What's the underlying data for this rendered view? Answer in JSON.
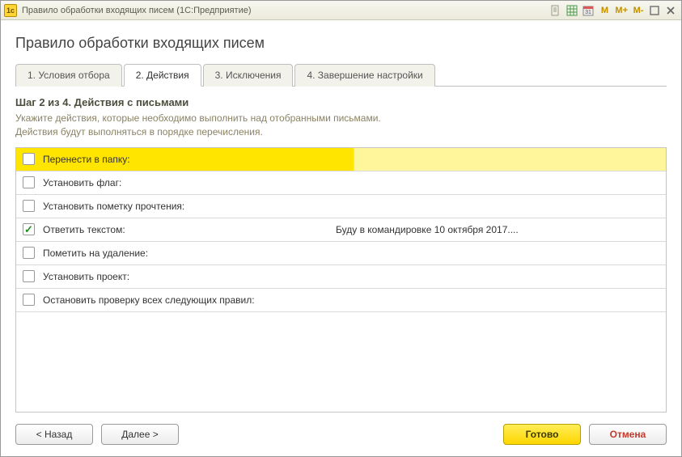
{
  "window": {
    "title": "Правило обработки входящих писем  (1С:Предприятие)"
  },
  "page": {
    "title": "Правило обработки входящих писем"
  },
  "tabs": [
    {
      "label": "1. Условия отбора"
    },
    {
      "label": "2. Действия"
    },
    {
      "label": "3. Исключения"
    },
    {
      "label": "4. Завершение настройки"
    }
  ],
  "step": {
    "title": "Шаг 2 из 4. Действия с письмами",
    "hint1": "Укажите действия, которые необходимо выполнить над отобранными письмами.",
    "hint2": "Действия будут выполняться в порядке перечисления."
  },
  "actions": [
    {
      "checked": false,
      "selected": true,
      "label": "Перенести в папку:",
      "value": ""
    },
    {
      "checked": false,
      "selected": false,
      "label": "Установить флаг:",
      "value": ""
    },
    {
      "checked": false,
      "selected": false,
      "label": "Установить пометку прочтения:",
      "value": ""
    },
    {
      "checked": true,
      "selected": false,
      "label": "Ответить текстом:",
      "value": "Буду в командировке 10 октября 2017...."
    },
    {
      "checked": false,
      "selected": false,
      "label": "Пометить на удаление:",
      "value": ""
    },
    {
      "checked": false,
      "selected": false,
      "label": "Установить проект:",
      "value": ""
    },
    {
      "checked": false,
      "selected": false,
      "label": "Остановить проверку всех следующих правил:",
      "value": ""
    }
  ],
  "buttons": {
    "back": "< Назад",
    "next": "Далее >",
    "finish": "Готово",
    "cancel": "Отмена"
  }
}
